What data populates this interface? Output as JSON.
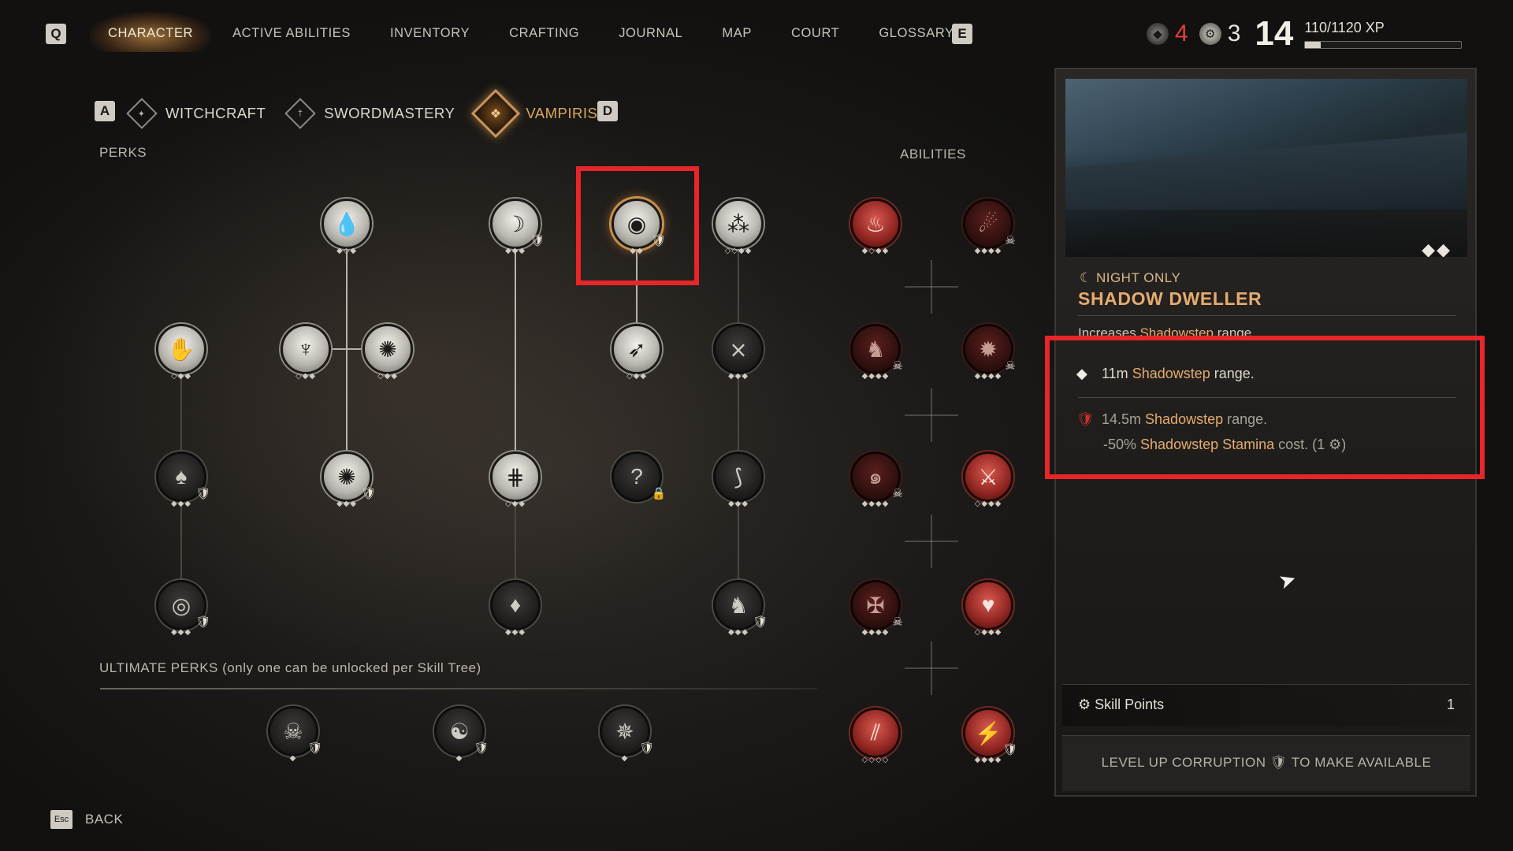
{
  "topbar": {
    "key_left": "Q",
    "key_right": "E",
    "nav": [
      "CHARACTER",
      "ACTIVE ABILITIES",
      "INVENTORY",
      "CRAFTING",
      "JOURNAL",
      "MAP",
      "COURT",
      "GLOSSARY"
    ],
    "active_nav": "CHARACTER",
    "corruption_points": "4",
    "skill_points_hud": "3",
    "level": "14",
    "xp_text": "110/1120 XP",
    "xp_fraction": 0.098
  },
  "tree_tabs": {
    "key_left": "A",
    "key_right": "D",
    "tabs": [
      {
        "label": "WITCHCRAFT",
        "icon": "witchcraft-icon"
      },
      {
        "label": "SWORDMASTERY",
        "icon": "swordmastery-icon"
      },
      {
        "label": "VAMPIRISM",
        "icon": "vampirism-icon"
      }
    ],
    "active": "VAMPIRISM"
  },
  "labels": {
    "perks": "PERKS",
    "abilities": "ABILITIES",
    "ultimate": "ULTIMATE PERKS (only one can be unlocked per Skill Tree)"
  },
  "detail": {
    "night": "☾ NIGHT ONLY",
    "title": "SHADOW DWELLER",
    "desc_prefix": "Increases ",
    "desc_hl": "Shadowstep",
    "desc_suffix": " range.",
    "rank1": {
      "prefix": "11m ",
      "hl": "Shadowstep",
      "suffix": " range."
    },
    "rank2_line1": {
      "prefix": "14.5m ",
      "hl": "Shadowstep",
      "suffix": " range."
    },
    "rank2_line2": {
      "prefix": "-50% ",
      "hl": "Shadowstep Stamina",
      "suffix": " cost. (1 ⚙)"
    },
    "skill_points_label": "Skill Points",
    "skill_points_value": "1",
    "level_up_text": "LEVEL UP CORRUPTION 🛡 TO MAKE AVAILABLE"
  },
  "footer": {
    "esc_key": "Esc",
    "back_label": "BACK"
  }
}
